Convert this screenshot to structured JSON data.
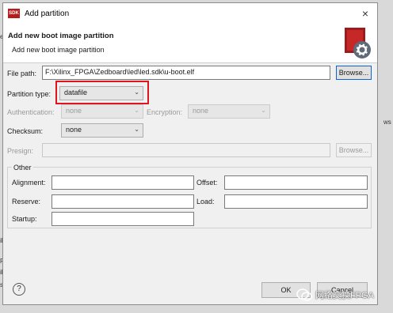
{
  "window": {
    "title": "Add partition",
    "app_icon_text": "SDK"
  },
  "banner": {
    "title": "Add new boot image partition",
    "subtitle": "Add new boot image partition",
    "icon": "settings-gear-icon"
  },
  "form": {
    "file_path_label": "File path:",
    "file_path_value": "F:\\Xilinx_FPGA\\Zedboard\\led\\led.sdk\\u-boot.elf",
    "browse_label": "Browse...",
    "partition_type_label": "Partition type:",
    "partition_type_value": "datafile",
    "authentication_label": "Authentication:",
    "authentication_value": "none",
    "encryption_label": "Encryption:",
    "encryption_value": "none",
    "checksum_label": "Checksum:",
    "checksum_value": "none",
    "presign_label": "Presign:",
    "presign_browse_label": "Browse..."
  },
  "other": {
    "group_label": "Other",
    "alignment_label": "Alignment:",
    "offset_label": "Offset:",
    "reserve_label": "Reserve:",
    "load_label": "Load:",
    "startup_label": "Startup:"
  },
  "footer": {
    "ok_label": "OK",
    "cancel_label": "Cancel",
    "help_symbol": "?"
  },
  "watermark": {
    "text": "网络交换FPGA"
  },
  "background_fragments": {
    "a": "e",
    "b": "ws",
    "c": "il",
    "d": "P",
    "e": "il",
    "f": "si"
  }
}
